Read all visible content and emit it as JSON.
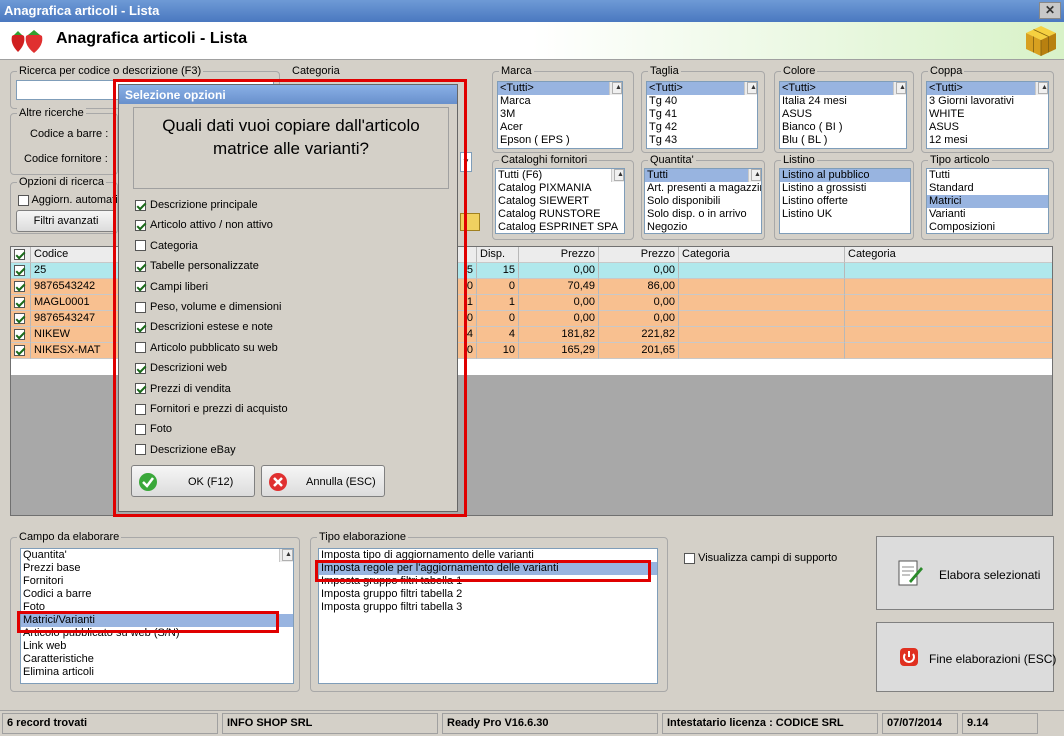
{
  "window": {
    "title": "Anagrafica articoli  - Lista",
    "header": "Anagrafica articoli  - Lista"
  },
  "search": {
    "label": "Ricerca per codice o descrizione (F3)",
    "value": "",
    "altre": "Altre ricerche",
    "barcode_label": "Codice a barre :",
    "supplier_code_label": "Codice fornitore :",
    "opzioni": "Opzioni di ricerca",
    "auto_update": "Aggiorn. automatico",
    "filters_button": "Filtri avanzati"
  },
  "categoria_label": "Categoria",
  "marca": {
    "label": "Marca",
    "items": [
      "<Tutti>",
      "Marca",
      "3M",
      "Acer",
      "Epson ( EPS )"
    ]
  },
  "taglia": {
    "label": "Taglia",
    "items": [
      "<Tutti>",
      "Tg 40",
      "Tg 41",
      "Tg 42",
      "Tg 43"
    ]
  },
  "colore": {
    "label": "Colore",
    "items": [
      "<Tutti>",
      "Italia 24 mesi",
      "ASUS",
      "Bianco ( BI )",
      "Blu ( BL )"
    ]
  },
  "coppa": {
    "label": "Coppa",
    "items": [
      "<Tutti>",
      "3 Giorni lavorativi",
      "WHITE",
      "ASUS",
      "12 mesi"
    ]
  },
  "cataloghi": {
    "label": "Cataloghi fornitori",
    "items": [
      "Tutti (F6)",
      "Catalog PIXMANIA",
      "Catalog SIEWERT",
      "Catalog RUNSTORE",
      "Catalog ESPRINET SPA"
    ]
  },
  "quantita": {
    "label": "Quantita'",
    "items": [
      "Tutti",
      "Art. presenti a magazzino",
      "Solo disponibili",
      "Solo disp. o in arrivo",
      "Negozio"
    ]
  },
  "listino": {
    "label": "Listino",
    "items": [
      "Listino al pubblico",
      "Listino a grossisti",
      "Listino offerte",
      "Listino UK"
    ]
  },
  "tipo_articolo": {
    "label": "Tipo articolo",
    "items": [
      "Tutti",
      "Standard",
      "Matrici",
      "Varianti",
      "Composizioni"
    ]
  },
  "grid": {
    "headers": [
      "Codice",
      "Disp.",
      "Prezzo",
      "Prezzo",
      "Categoria",
      "Categoria"
    ],
    "rows": [
      {
        "codice": "25",
        "hidden": "5",
        "disp": "15",
        "p1": "0,00",
        "p2": "0,00",
        "color": "#b0e8ec"
      },
      {
        "codice": "9876543242",
        "hidden": "0",
        "disp": "0",
        "p1": "70,49",
        "p2": "86,00",
        "color": "#f8c090"
      },
      {
        "codice": "MAGL0001",
        "hidden": "1",
        "disp": "1",
        "p1": "0,00",
        "p2": "0,00",
        "color": "#f8c090"
      },
      {
        "codice": "9876543247",
        "hidden": "0",
        "disp": "0",
        "p1": "0,00",
        "p2": "0,00",
        "color": "#f8c090"
      },
      {
        "codice": "NIKEW",
        "hidden": "4",
        "disp": "4",
        "p1": "181,82",
        "p2": "221,82",
        "color": "#f8c090"
      },
      {
        "codice": "NIKESX-MAT",
        "hidden": "0",
        "disp": "10",
        "p1": "165,29",
        "p2": "201,65",
        "color": "#f8c090"
      }
    ]
  },
  "dialog": {
    "title": "Selezione opzioni",
    "question": "Quali dati vuoi copiare dall'articolo matrice alle varianti?",
    "options": [
      {
        "label": "Descrizione principale",
        "checked": true
      },
      {
        "label": "Articolo attivo / non attivo",
        "checked": true
      },
      {
        "label": "Categoria",
        "checked": false
      },
      {
        "label": "Tabelle personalizzate",
        "checked": true
      },
      {
        "label": "Campi liberi",
        "checked": true
      },
      {
        "label": "Peso, volume e dimensioni",
        "checked": false
      },
      {
        "label": "Descrizioni estese e note",
        "checked": true
      },
      {
        "label": "Articolo pubblicato su web",
        "checked": false
      },
      {
        "label": "Descrizioni web",
        "checked": true
      },
      {
        "label": "Prezzi di vendita",
        "checked": true
      },
      {
        "label": "Fornitori e prezzi di acquisto",
        "checked": false
      },
      {
        "label": "Foto",
        "checked": false
      },
      {
        "label": "Descrizione eBay",
        "checked": false
      }
    ],
    "ok": "OK (F12)",
    "cancel": "Annulla (ESC)"
  },
  "campo": {
    "label": "Campo da elaborare",
    "items": [
      "Quantita'",
      "Prezzi base",
      "Fornitori",
      "Codici a barre",
      "Foto",
      "Matrici/Varianti",
      "Articolo pubblicato su web (S/N)",
      "Link web",
      "Caratteristiche",
      "Elimina articoli"
    ],
    "selected": 5
  },
  "tipo": {
    "label": "Tipo elaborazione",
    "items": [
      "Imposta tipo di aggiornamento delle varianti",
      "Imposta regole per l'aggiornamento delle varianti",
      "Imposta gruppo filtri tabella 1",
      "Imposta gruppo filtri tabella 2",
      "Imposta gruppo filtri tabella 3"
    ],
    "selected": 1
  },
  "support": "Visualizza campi di supporto",
  "elabora": "Elabora selezionati",
  "fine": "Fine elaborazioni (ESC)",
  "status": {
    "records": "6 record trovati",
    "company": "INFO SHOP SRL",
    "product": "Ready Pro V16.6.30",
    "license": "Intestatario licenza : CODICE SRL",
    "date": "07/07/2014",
    "version": "9.14"
  }
}
